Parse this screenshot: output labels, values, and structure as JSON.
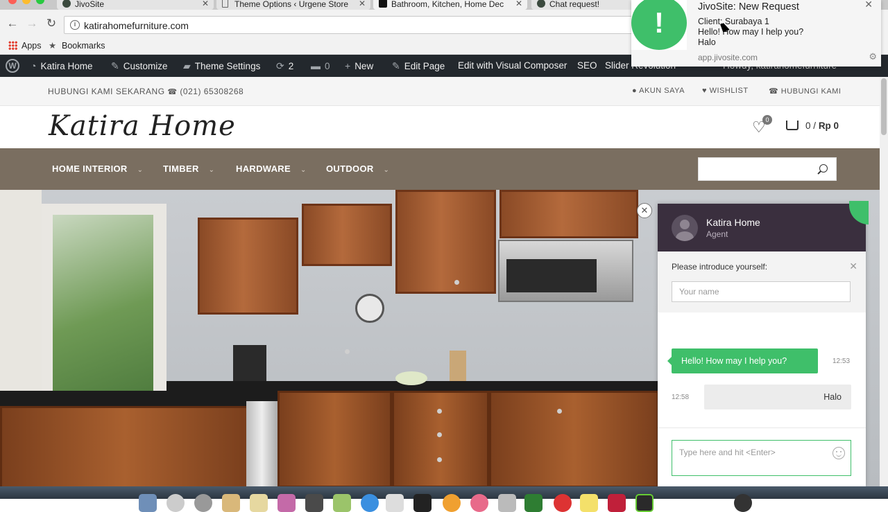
{
  "browser": {
    "tabs": [
      {
        "label": "JivoSite"
      },
      {
        "label": "Theme Options ‹ Urgene Store"
      },
      {
        "label": "Bathroom, Kitchen, Home Dec"
      },
      {
        "label": "Chat request!"
      }
    ],
    "url": "katirahomefurniture.com",
    "bookmarks": {
      "apps": "Apps",
      "bookmarks": "Bookmarks"
    }
  },
  "admin_bar": {
    "site": "Katira Home",
    "customize": "Customize",
    "theme_settings": "Theme Settings",
    "updates": "2",
    "comments": "0",
    "new": "New",
    "edit_page": "Edit Page",
    "visual_composer": "Edit with Visual Composer",
    "seo": "SEO",
    "slider": "Slider Revolution",
    "howdy": "Howdy, katirahomefurniture"
  },
  "topbar": {
    "contact": "HUBUNGI KAMI SEKARANG",
    "phone": "(021) 65308268",
    "account": "AKUN SAYA",
    "wishlist": "WISHLIST",
    "contact_us": "HUBUNGI KAMI"
  },
  "header": {
    "logo": "Katira Home",
    "wishlist_count": "0",
    "cart_count": "0",
    "cart_sep": "/",
    "cart_total": "Rp 0"
  },
  "nav": [
    {
      "label": "HOME INTERIOR"
    },
    {
      "label": "TIMBER"
    },
    {
      "label": "HARDWARE"
    },
    {
      "label": "OUTDOOR"
    }
  ],
  "search": {
    "placeholder": ""
  },
  "chat": {
    "agent_name": "Katira Home",
    "agent_role": "Agent",
    "intro_label": "Please introduce yourself:",
    "name_placeholder": "Your name",
    "messages": [
      {
        "text": "Hello! How may I help you?",
        "time": "12:53"
      },
      {
        "text": "Halo",
        "time": "12:58"
      }
    ],
    "input_placeholder": "Type here and hit <Enter>"
  },
  "notification": {
    "title": "JivoSite: New Request",
    "line1": "Client: Surabaya 1",
    "line2": "Hello! How may I help you?",
    "line3": "Halo",
    "source": "app.jivosite.com"
  },
  "colors": {
    "nav_bg": "#7a6e60",
    "chat_header": "#3a2f3e",
    "accent_green": "#3fbf6a",
    "admin_bar": "#23282d"
  }
}
